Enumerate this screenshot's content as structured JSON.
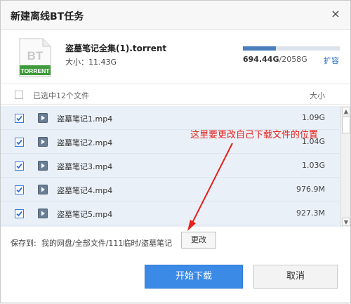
{
  "dialog": {
    "title": "新建离线BT任务",
    "close_glyph": "×"
  },
  "torrent": {
    "icon_top_text": "BT",
    "icon_band_text": "TORRENT",
    "name": "盗墓笔记全集(1).torrent",
    "size_label": "大小：",
    "size_value": "11.43G"
  },
  "quota": {
    "used": "694.44G",
    "total": "/2058G",
    "used_fraction": 0.337,
    "expand_label": "扩容"
  },
  "list_header": {
    "selected_text": "已选中12个文件",
    "size_column": "大小"
  },
  "files": [
    {
      "name": "盗墓笔记1.mp4",
      "size": "1.09G",
      "checked": true
    },
    {
      "name": "盗墓笔记2.mp4",
      "size": "1.04G",
      "checked": true
    },
    {
      "name": "盗墓笔记3.mp4",
      "size": "1.03G",
      "checked": true
    },
    {
      "name": "盗墓笔记4.mp4",
      "size": "976.9M",
      "checked": true
    },
    {
      "name": "盗墓笔记5.mp4",
      "size": "927.3M",
      "checked": true
    }
  ],
  "annotation": {
    "text": "这里要更改自己下载文件的位置"
  },
  "save": {
    "label": "保存到:",
    "path": "我的网盘/全部文件/111临时/盗墓笔记",
    "change_button": "更改"
  },
  "actions": {
    "start_download": "开始下载",
    "cancel": "取消"
  },
  "colors": {
    "accent": "#3b8ae6",
    "annotation": "#e8201b",
    "link": "#2a6fc9",
    "bt_icon_band": "#3e9a3a"
  }
}
